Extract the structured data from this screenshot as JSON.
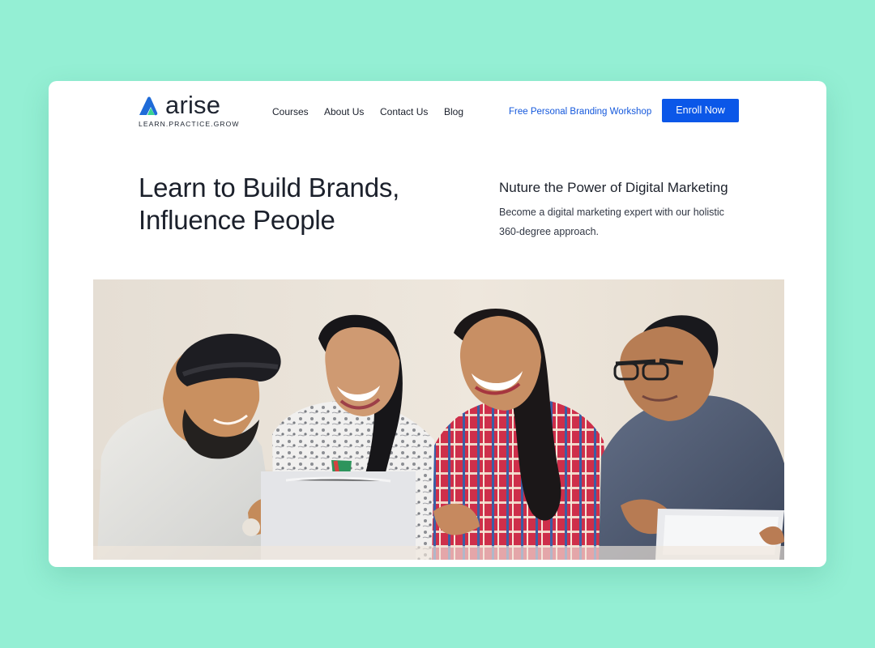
{
  "brand": {
    "name": "arise",
    "tagline": "LEARN.PRACTICE.GROW",
    "logo_icon": "arise-logo-icon",
    "colors": {
      "logo_dark": "#1f6bd8",
      "logo_light": "#39d392",
      "accent": "#0b57e8"
    }
  },
  "header": {
    "nav": [
      {
        "label": "Courses"
      },
      {
        "label": "About Us"
      },
      {
        "label": "Contact Us"
      },
      {
        "label": "Blog"
      }
    ],
    "workshop_link": "Free Personal Branding Workshop",
    "enroll_button": "Enroll Now"
  },
  "hero": {
    "title_line_1": "Learn to Build Brands,",
    "title_line_2": "Influence People",
    "subtitle": "Nuture the Power of Digital Marketing",
    "description_line_1": "Become a digital marketing expert with our holistic",
    "description_line_2": "360-degree approach."
  },
  "page": {
    "background": "#94efd4",
    "card_background": "#ffffff"
  }
}
